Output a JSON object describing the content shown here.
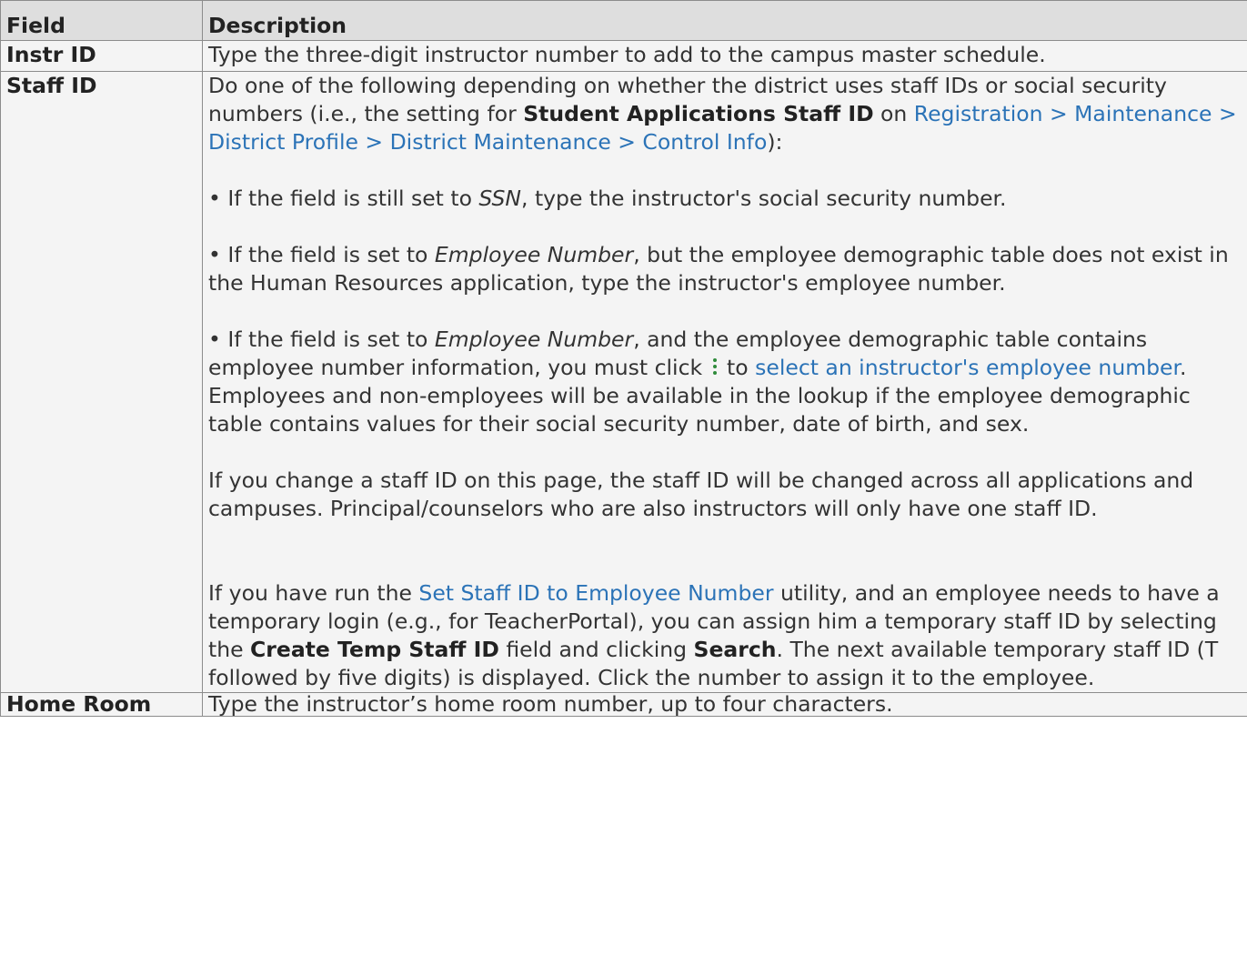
{
  "table": {
    "headers": {
      "field": "Field",
      "description": "Description"
    },
    "instr_id": {
      "label": "Instr ID",
      "text": "Type the three-digit instructor number to add to the campus master schedule."
    },
    "staff_id": {
      "label": "Staff ID",
      "intro": {
        "t1": "Do one of the following depending on whether the district uses staff IDs or social security numbers (i.e., the setting for ",
        "b1": "Student Applications Staff ID",
        "t2": " on ",
        "link": "Registration > Maintenance > District Profile > District Maintenance > Control Info",
        "t3": "):"
      },
      "bullet1": {
        "t1": "• If the field is still set to ",
        "i1": "SSN",
        "t2": ", type the instructor's social security number."
      },
      "bullet2": {
        "t1": "• If the field is set to ",
        "i1": "Employee Number",
        "t2": ", but the employee demographic table does not exist in the Human Resources application, type the instructor's employee number."
      },
      "bullet3": {
        "t1": "• If the field is set to ",
        "i1": "Employee Number",
        "t2": ", and the employee demographic table contains employee number information, you must click ",
        "icon": "kebab-vertical-icon",
        "t3": " to ",
        "link": "select an instructor's employee number",
        "t4": ". Employees and non-employees will be available in the lookup if the employee demographic table contains values for their social security number, date of birth, and sex."
      },
      "change_note": "If you change a staff ID on this page, the staff ID will be changed across all applications and campuses. Principal/counselors who are also instructors will only have one staff ID.",
      "temp": {
        "t1": "If you have run the ",
        "link": "Set Staff ID to Employee Number",
        "t2": " utility, and an employee needs to have a temporary login (e.g., for TeacherPortal), you can assign him a temporary staff ID by selecting the ",
        "b1": "Create Temp Staff ID",
        "t3": " field and clicking ",
        "b2": "Search",
        "t4": ". The next available temporary staff ID (T followed by five digits) is displayed. Click the number to assign it to the employee."
      }
    },
    "home_room": {
      "label": "Home Room",
      "text": "Type the instructor’s home room number, up to four characters."
    }
  },
  "colors": {
    "link": "#2b73b7",
    "icon": "#2e8b3a",
    "header_bg": "#dedede",
    "row_bg": "#f4f4f4",
    "border": "#8c8c8c"
  }
}
